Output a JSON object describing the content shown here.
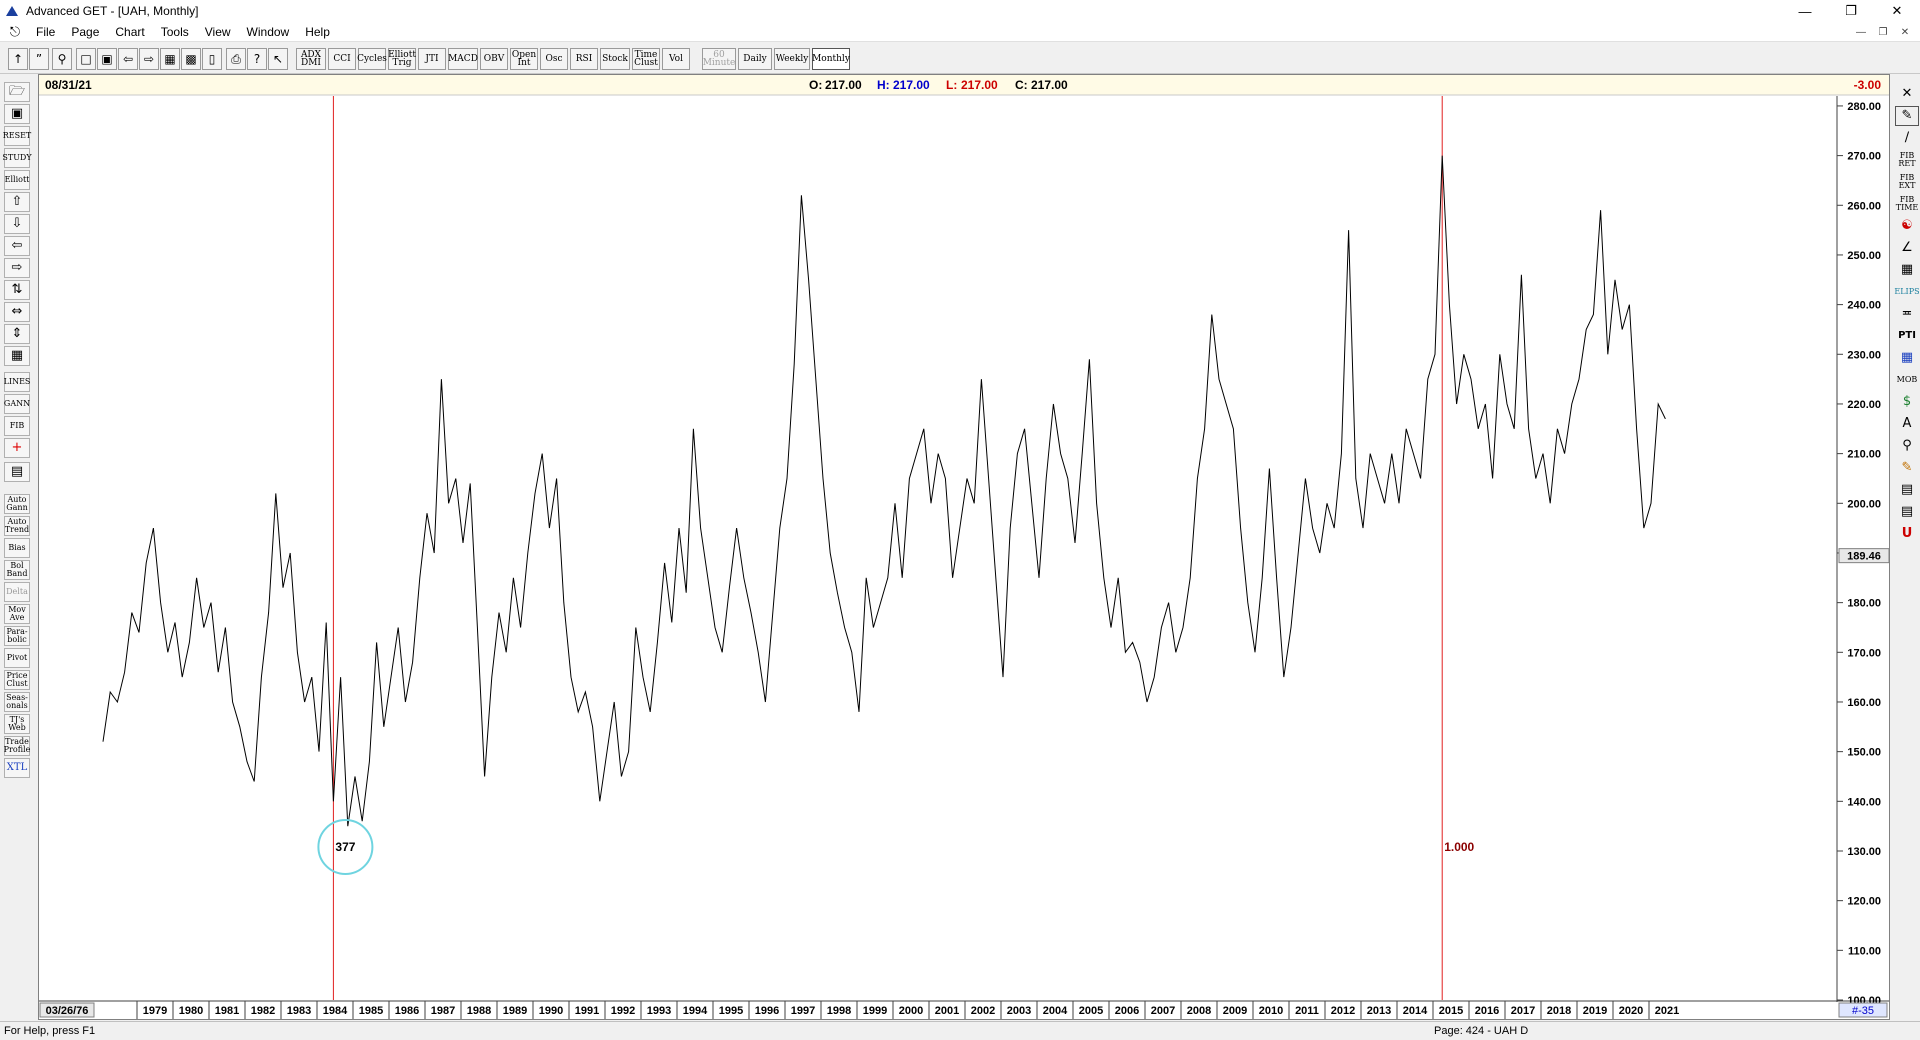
{
  "window": {
    "title": "Advanced GET - [UAH, Monthly]"
  },
  "menu": [
    "File",
    "Page",
    "Chart",
    "Tools",
    "View",
    "Window",
    "Help"
  ],
  "toolbar": {
    "study_buttons": [
      "ADX DMI",
      "CCI",
      "Cycles",
      "Elliott Trig",
      "JTI",
      "MACD",
      "OBV",
      "Open Int",
      "Osc",
      "RSI",
      "Stock",
      "Time Clust",
      "Vol"
    ],
    "timeframes": [
      "60 Minute",
      "Daily",
      "Weekly",
      "Monthly"
    ],
    "active_timeframe": "Monthly"
  },
  "left_toolbar": {
    "labeled_buttons": [
      "RESET",
      "STUDY",
      "Elliott",
      "LINES",
      "GANN",
      "FIB"
    ],
    "study_buttons": [
      "Auto Gann",
      "Auto Trend",
      "Bias",
      "Bol Band",
      "Delta",
      "Mov Ave",
      "Para-bolic",
      "Pivot",
      "Price Clust",
      "Seas-onals",
      "TJ's Web",
      "Trade Profile",
      "XTL"
    ]
  },
  "right_toolbar": {
    "labeled_buttons": [
      "FIB RET",
      "FIB EXT",
      "FIB TIME",
      "ELIPS",
      "PTI",
      "MOB"
    ]
  },
  "info_bar": {
    "date": "08/31/21",
    "open_label": "O:",
    "open": "217.00",
    "high_label": "H:",
    "high": "217.00",
    "low_label": "L:",
    "low": "217.00",
    "close_label": "C:",
    "close": "217.00",
    "change": "-3.00"
  },
  "chart_data": {
    "type": "line",
    "title": "",
    "symbol": "UAH",
    "interval": "Monthly",
    "x_start_label": "03/26/76",
    "x_labels": [
      "1979",
      "1980",
      "1981",
      "1982",
      "1983",
      "1984",
      "1985",
      "1986",
      "1987",
      "1988",
      "1989",
      "1990",
      "1991",
      "1992",
      "1993",
      "1994",
      "1995",
      "1996",
      "1997",
      "1998",
      "1999",
      "2000",
      "2001",
      "2002",
      "2003",
      "2004",
      "2005",
      "2006",
      "2007",
      "2008",
      "2009",
      "2010",
      "2011",
      "2012",
      "2013",
      "2014",
      "2015",
      "2016",
      "2017",
      "2018",
      "2019",
      "2020",
      "2021"
    ],
    "y_ticks": [
      100,
      110,
      120,
      130,
      140,
      150,
      160,
      170,
      180,
      190,
      200,
      210,
      220,
      230,
      240,
      250,
      260,
      270,
      280
    ],
    "ylim": [
      100,
      282
    ],
    "current_price": "189.46",
    "x_end_label": "#-35",
    "grid": false,
    "series": [
      {
        "points": [
          [
            1978.0,
            152
          ],
          [
            1978.2,
            162
          ],
          [
            1978.4,
            160
          ],
          [
            1978.6,
            166
          ],
          [
            1978.8,
            178
          ],
          [
            1979.0,
            174
          ],
          [
            1979.2,
            188
          ],
          [
            1979.4,
            195
          ],
          [
            1979.6,
            180
          ],
          [
            1979.8,
            170
          ],
          [
            1980.0,
            176
          ],
          [
            1980.2,
            165
          ],
          [
            1980.4,
            172
          ],
          [
            1980.6,
            185
          ],
          [
            1980.8,
            175
          ],
          [
            1981.0,
            180
          ],
          [
            1981.2,
            166
          ],
          [
            1981.4,
            175
          ],
          [
            1981.6,
            160
          ],
          [
            1981.8,
            155
          ],
          [
            1982.0,
            148
          ],
          [
            1982.2,
            144
          ],
          [
            1982.4,
            165
          ],
          [
            1982.6,
            178
          ],
          [
            1982.8,
            202
          ],
          [
            1983.0,
            183
          ],
          [
            1983.2,
            190
          ],
          [
            1983.4,
            170
          ],
          [
            1983.6,
            160
          ],
          [
            1983.8,
            165
          ],
          [
            1984.0,
            150
          ],
          [
            1984.2,
            176
          ],
          [
            1984.4,
            140
          ],
          [
            1984.6,
            165
          ],
          [
            1984.8,
            135
          ],
          [
            1985.0,
            145
          ],
          [
            1985.2,
            136
          ],
          [
            1985.4,
            148
          ],
          [
            1985.6,
            172
          ],
          [
            1985.8,
            155
          ],
          [
            1986.0,
            165
          ],
          [
            1986.2,
            175
          ],
          [
            1986.4,
            160
          ],
          [
            1986.6,
            168
          ],
          [
            1986.8,
            185
          ],
          [
            1987.0,
            198
          ],
          [
            1987.2,
            190
          ],
          [
            1987.4,
            225
          ],
          [
            1987.6,
            200
          ],
          [
            1987.8,
            205
          ],
          [
            1988.0,
            192
          ],
          [
            1988.2,
            204
          ],
          [
            1988.4,
            175
          ],
          [
            1988.6,
            145
          ],
          [
            1988.8,
            165
          ],
          [
            1989.0,
            178
          ],
          [
            1989.2,
            170
          ],
          [
            1989.4,
            185
          ],
          [
            1989.6,
            175
          ],
          [
            1989.8,
            190
          ],
          [
            1990.0,
            202
          ],
          [
            1990.2,
            210
          ],
          [
            1990.4,
            195
          ],
          [
            1990.6,
            205
          ],
          [
            1990.8,
            180
          ],
          [
            1991.0,
            165
          ],
          [
            1991.2,
            158
          ],
          [
            1991.4,
            162
          ],
          [
            1991.6,
            155
          ],
          [
            1991.8,
            140
          ],
          [
            1992.0,
            150
          ],
          [
            1992.2,
            160
          ],
          [
            1992.4,
            145
          ],
          [
            1992.6,
            150
          ],
          [
            1992.8,
            175
          ],
          [
            1993.0,
            165
          ],
          [
            1993.2,
            158
          ],
          [
            1993.4,
            172
          ],
          [
            1993.6,
            188
          ],
          [
            1993.8,
            176
          ],
          [
            1994.0,
            195
          ],
          [
            1994.2,
            182
          ],
          [
            1994.4,
            215
          ],
          [
            1994.6,
            195
          ],
          [
            1994.8,
            185
          ],
          [
            1995.0,
            175
          ],
          [
            1995.2,
            170
          ],
          [
            1995.4,
            183
          ],
          [
            1995.6,
            195
          ],
          [
            1995.8,
            185
          ],
          [
            1996.0,
            178
          ],
          [
            1996.2,
            170
          ],
          [
            1996.4,
            160
          ],
          [
            1996.8,
            195
          ],
          [
            1997.0,
            205
          ],
          [
            1997.2,
            228
          ],
          [
            1997.4,
            262
          ],
          [
            1997.6,
            245
          ],
          [
            1997.8,
            225
          ],
          [
            1998.0,
            205
          ],
          [
            1998.2,
            190
          ],
          [
            1998.4,
            182
          ],
          [
            1998.6,
            175
          ],
          [
            1998.8,
            170
          ],
          [
            1999.0,
            158
          ],
          [
            1999.2,
            185
          ],
          [
            1999.4,
            175
          ],
          [
            1999.6,
            180
          ],
          [
            1999.8,
            185
          ],
          [
            2000.0,
            200
          ],
          [
            2000.2,
            185
          ],
          [
            2000.4,
            205
          ],
          [
            2000.6,
            210
          ],
          [
            2000.8,
            215
          ],
          [
            2001.0,
            200
          ],
          [
            2001.2,
            210
          ],
          [
            2001.4,
            205
          ],
          [
            2001.6,
            185
          ],
          [
            2001.8,
            195
          ],
          [
            2002.0,
            205
          ],
          [
            2002.2,
            200
          ],
          [
            2002.4,
            225
          ],
          [
            2002.6,
            205
          ],
          [
            2002.8,
            185
          ],
          [
            2003.0,
            165
          ],
          [
            2003.2,
            195
          ],
          [
            2003.4,
            210
          ],
          [
            2003.6,
            215
          ],
          [
            2003.8,
            200
          ],
          [
            2004.0,
            185
          ],
          [
            2004.2,
            205
          ],
          [
            2004.4,
            220
          ],
          [
            2004.6,
            210
          ],
          [
            2004.8,
            205
          ],
          [
            2005.0,
            192
          ],
          [
            2005.2,
            210
          ],
          [
            2005.4,
            229
          ],
          [
            2005.6,
            200
          ],
          [
            2005.8,
            185
          ],
          [
            2006.0,
            175
          ],
          [
            2006.2,
            185
          ],
          [
            2006.4,
            170
          ],
          [
            2006.6,
            172
          ],
          [
            2006.8,
            168
          ],
          [
            2007.0,
            160
          ],
          [
            2007.2,
            165
          ],
          [
            2007.4,
            175
          ],
          [
            2007.6,
            180
          ],
          [
            2007.8,
            170
          ],
          [
            2008.0,
            175
          ],
          [
            2008.2,
            185
          ],
          [
            2008.4,
            205
          ],
          [
            2008.6,
            215
          ],
          [
            2008.8,
            238
          ],
          [
            2009.0,
            225
          ],
          [
            2009.2,
            220
          ],
          [
            2009.4,
            215
          ],
          [
            2009.6,
            195
          ],
          [
            2009.8,
            180
          ],
          [
            2010.0,
            170
          ],
          [
            2010.2,
            185
          ],
          [
            2010.4,
            207
          ],
          [
            2010.6,
            185
          ],
          [
            2010.8,
            165
          ],
          [
            2011.0,
            175
          ],
          [
            2011.2,
            190
          ],
          [
            2011.4,
            205
          ],
          [
            2011.6,
            195
          ],
          [
            2011.8,
            190
          ],
          [
            2012.0,
            200
          ],
          [
            2012.2,
            195
          ],
          [
            2012.4,
            210
          ],
          [
            2012.6,
            255
          ],
          [
            2012.8,
            205
          ],
          [
            2013.0,
            195
          ],
          [
            2013.2,
            210
          ],
          [
            2013.4,
            205
          ],
          [
            2013.6,
            200
          ],
          [
            2013.8,
            210
          ],
          [
            2014.0,
            200
          ],
          [
            2014.2,
            215
          ],
          [
            2014.4,
            210
          ],
          [
            2014.6,
            205
          ],
          [
            2014.8,
            225
          ],
          [
            2015.0,
            230
          ],
          [
            2015.2,
            270
          ],
          [
            2015.4,
            240
          ],
          [
            2015.6,
            220
          ],
          [
            2015.8,
            230
          ],
          [
            2016.0,
            225
          ],
          [
            2016.2,
            215
          ],
          [
            2016.4,
            220
          ],
          [
            2016.6,
            205
          ],
          [
            2016.8,
            230
          ],
          [
            2017.0,
            220
          ],
          [
            2017.2,
            215
          ],
          [
            2017.4,
            246
          ],
          [
            2017.6,
            215
          ],
          [
            2017.8,
            205
          ],
          [
            2018.0,
            210
          ],
          [
            2018.2,
            200
          ],
          [
            2018.4,
            215
          ],
          [
            2018.6,
            210
          ],
          [
            2018.8,
            220
          ],
          [
            2019.0,
            225
          ],
          [
            2019.2,
            235
          ],
          [
            2019.4,
            238
          ],
          [
            2019.6,
            259
          ],
          [
            2019.8,
            230
          ],
          [
            2020.0,
            245
          ],
          [
            2020.2,
            235
          ],
          [
            2020.4,
            240
          ],
          [
            2020.6,
            215
          ],
          [
            2020.8,
            195
          ],
          [
            2021.0,
            200
          ],
          [
            2021.2,
            220
          ],
          [
            2021.4,
            217
          ]
        ]
      }
    ],
    "vertical_lines": [
      {
        "year": 1984.4,
        "color": "#e02020"
      },
      {
        "year": 2015.2,
        "color": "#e02020"
      }
    ],
    "annotations": [
      {
        "text": "377",
        "year": 1984.4,
        "price": 130,
        "circle": true,
        "color": "#000000",
        "circle_color": "#6fd4e0"
      },
      {
        "text": "1.000",
        "year": 2015.2,
        "price": 130,
        "color": "#8b0000"
      }
    ]
  },
  "statusbar": {
    "help": "For Help, press F1",
    "page": "Page: 424 - UAH D"
  },
  "colors": {
    "up": "#0000cc",
    "down": "#cc0000",
    "neutral": "#000000",
    "cycle_line": "#e02020",
    "circle": "#6fd4e0"
  }
}
